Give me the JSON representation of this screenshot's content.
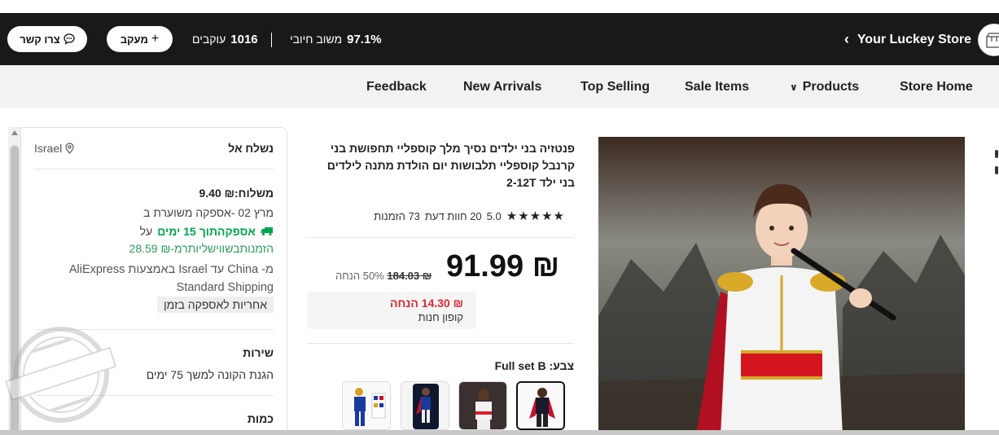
{
  "store": {
    "name": "Your Luckey Store",
    "positive_rating_value": "97.1%",
    "positive_rating_label": "משוב חיובי",
    "followers_value": "1016",
    "followers_label": "עוקבים",
    "follow_button": "מעקב",
    "contact_button": "צרו קשר"
  },
  "nav": {
    "items": [
      "Store Home",
      "Products",
      "Sale Items",
      "Top Selling",
      "New Arrivals",
      "Feedback"
    ]
  },
  "shipping": {
    "ship_to_label": "נשלח אל",
    "ship_to_location": "Israel",
    "shipping_cost": "משלוח:₪ 9.40",
    "delivery_estimate": "מרץ 02 -אספקה משוערת ב",
    "fast_delivery": "אספקהתוך 15 ימים",
    "fast_delivery_suffix": "על",
    "fast_delivery_price": "הזמנותבשווישליותרמ-₪ 28.59",
    "route": "מ- China עד Israel באמצעות AliExpress Standard Shipping",
    "guarantee_chip": "אחריות לאספקה בזמן",
    "service_title": "שירות",
    "buyer_protection": "הגנת הקונה למשך 75 ימים",
    "quantity_title": "כמות"
  },
  "product": {
    "title": "פנטזיה בני ילדים נסיך מלך קוספליי תחפושת בני קרנבל קוספליי תלבושות יום הולדת מתנה לילדים בני ילד 2-12T",
    "rating": "5.0",
    "reviews": "20 חוות דעת",
    "orders": "73 הזמנות",
    "price": "₪ 91.99",
    "old_price": "₪ 184.03",
    "discount": "50% הנחה",
    "coupon_amount": "₪ 14.30 הנחה",
    "coupon_label": "קופון חנות",
    "color_label": "צבע:",
    "color_value": "Full set B"
  },
  "colors": {
    "brand_black": "#191919",
    "nav_bg": "#f2f2f2",
    "green": "#00a650",
    "red": "#e0262f"
  }
}
